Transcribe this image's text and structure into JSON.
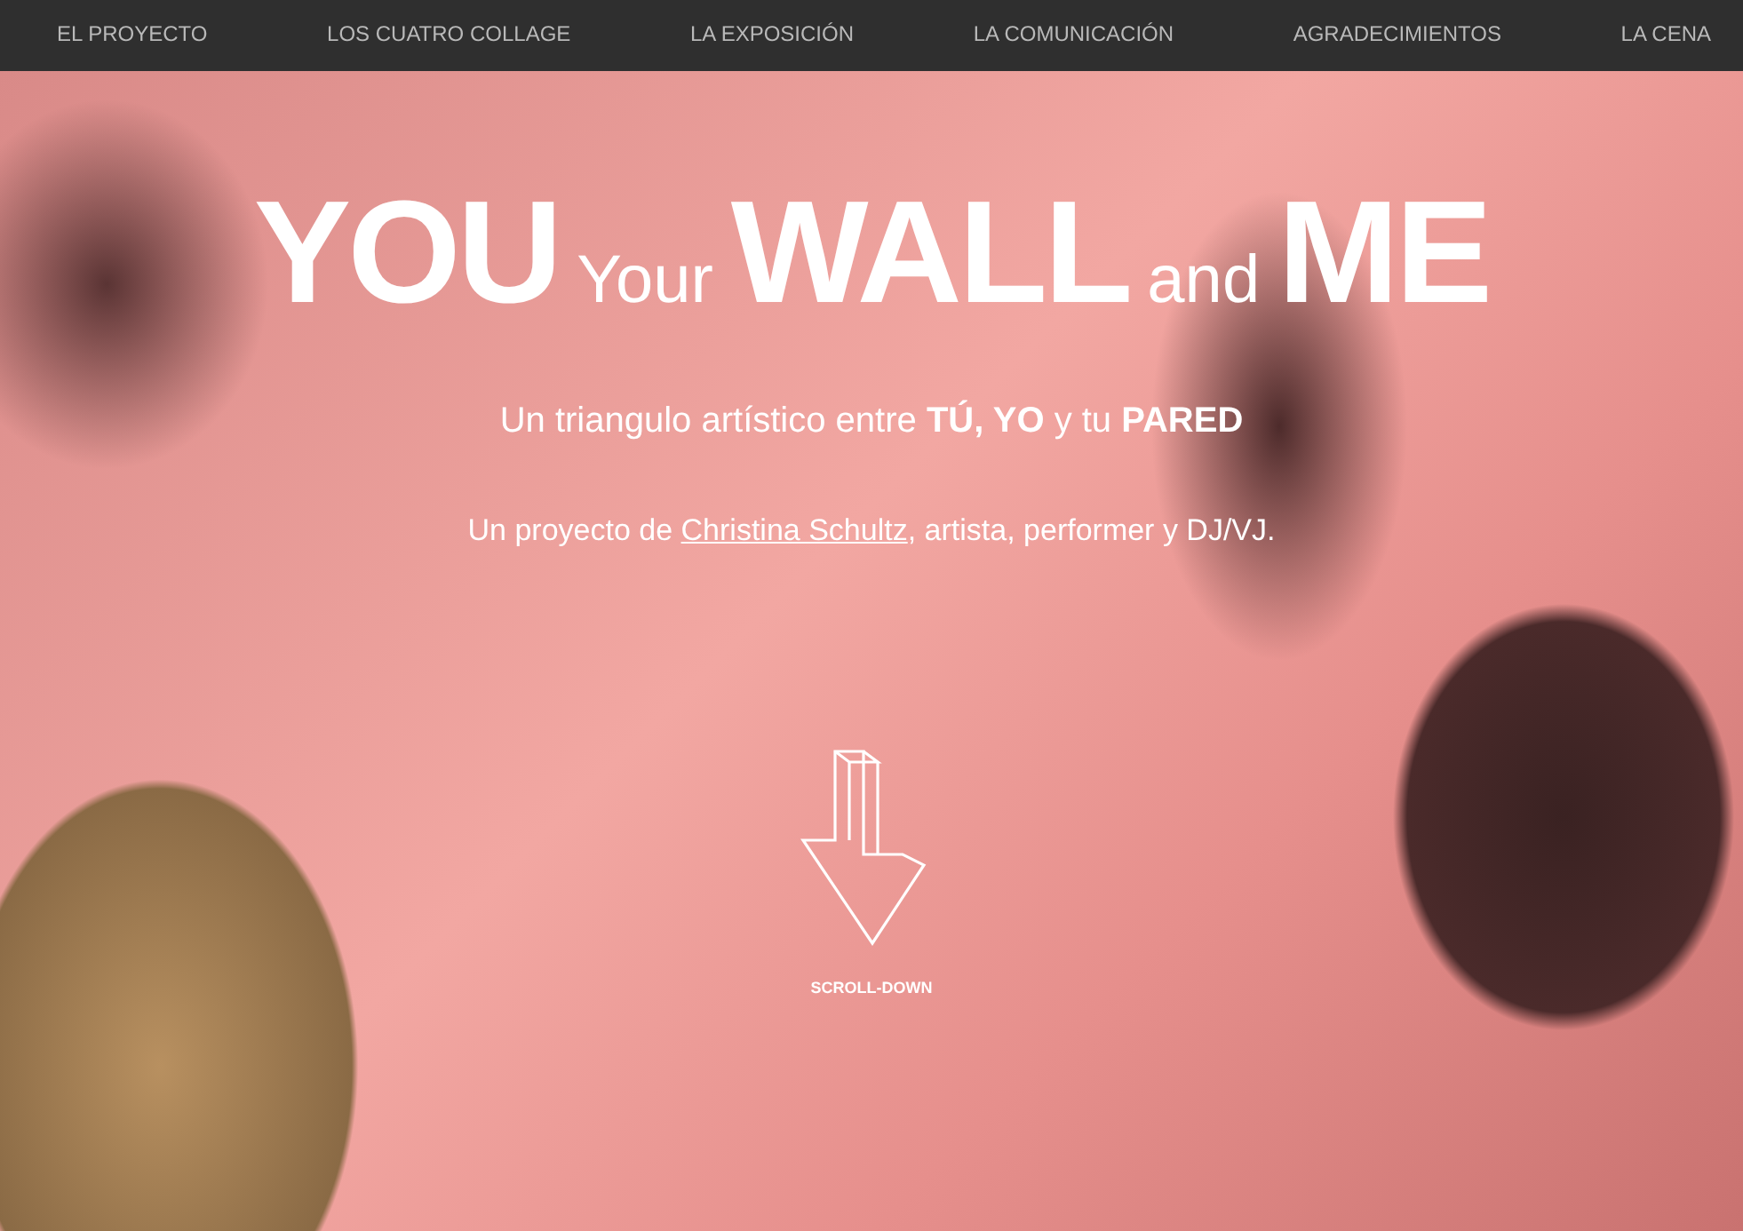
{
  "nav": {
    "items": [
      {
        "label": "EL PROYECTO",
        "selected": false
      },
      {
        "label": "LOS CUATRO COLLAGE",
        "selected": false
      },
      {
        "label": "LA EXPOSICIÓN",
        "selected": false
      },
      {
        "label": "LA COMUNICACIÓN",
        "selected": false
      },
      {
        "label": "AGRADECIMIENTOS",
        "selected": false
      },
      {
        "label": "LA CENA",
        "selected": false
      }
    ]
  },
  "hero": {
    "title": [
      {
        "text": "YOU",
        "kind": "big"
      },
      {
        "text": "Your",
        "kind": "small"
      },
      {
        "text": "WALL",
        "kind": "big"
      },
      {
        "text": "and",
        "kind": "small"
      },
      {
        "text": "ME",
        "kind": "big"
      }
    ],
    "subtitle": "Un triangulo artístico entre **TÚ, YO** y tu **PARED**",
    "byline": {
      "before": "Un proyecto de",
      "link": "Christina Schultz",
      "after": ", artista, performer y DJ/VJ."
    },
    "scroll_label": "SCROLL-DOWN"
  }
}
